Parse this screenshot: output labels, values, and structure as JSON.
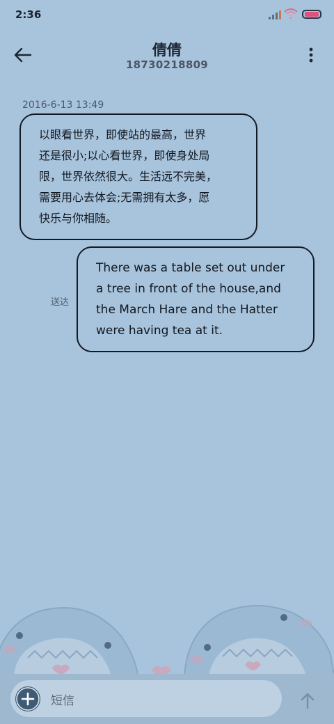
{
  "status_bar": {
    "time": "2:36",
    "icons": [
      "signal-icon",
      "wifi-icon",
      "battery-icon"
    ]
  },
  "header": {
    "contact_name": "倩倩",
    "contact_number": "18730218809",
    "icons": [
      "back-arrow-icon",
      "more-vertical-icon"
    ]
  },
  "conversation": {
    "timestamp": "2016-6-13 13:49",
    "messages": [
      {
        "direction": "incoming",
        "lines": [
          "以眼看世界，即使站的最高，世界",
          "还是很小;以心看世界，即使身处局",
          "限，世界依然很大。生活远不完美，",
          "需要用心去体会;无需拥有太多，愿",
          "快乐与你相随。"
        ]
      },
      {
        "direction": "outgoing",
        "status": "送达",
        "lines": [
          "There was a table set out under",
          "a tree in front of the house,and",
          "the March Hare and the Hatter",
          "were having tea at it."
        ]
      }
    ]
  },
  "composer": {
    "placeholder": "短信",
    "icons": [
      "add-icon",
      "send-arrow-icon"
    ]
  },
  "colors": {
    "background": "#a8c4dd",
    "bubble_border": "#141a22",
    "input_bar": "#9db8cf",
    "input_field": "#bdd1e2",
    "add_button": "#3f5a75",
    "battery_fill": "#e0507a"
  }
}
